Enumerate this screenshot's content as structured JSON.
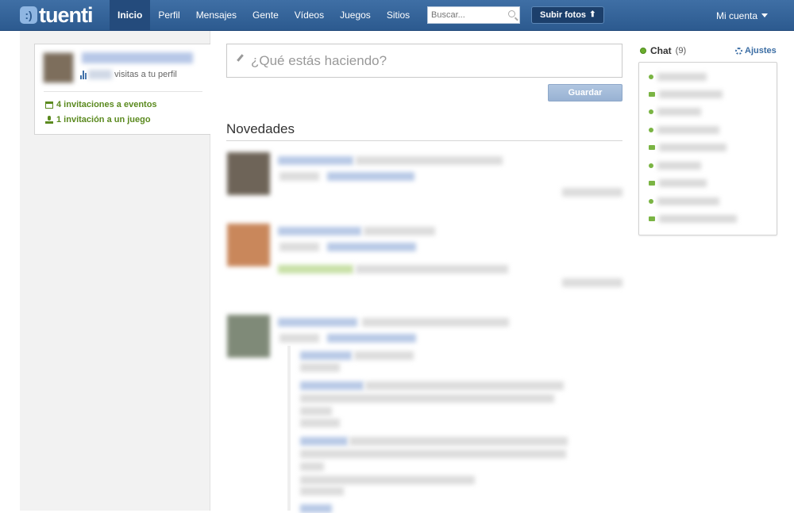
{
  "header": {
    "logo_text": "tuenti",
    "nav": [
      {
        "label": "Inicio",
        "active": true
      },
      {
        "label": "Perfil",
        "active": false
      },
      {
        "label": "Mensajes",
        "active": false
      },
      {
        "label": "Gente",
        "active": false
      },
      {
        "label": "Vídeos",
        "active": false
      },
      {
        "label": "Juegos",
        "active": false
      },
      {
        "label": "Sitios",
        "active": false
      }
    ],
    "search_placeholder": "Buscar...",
    "upload_label": "Subir fotos",
    "account_label": "Mi cuenta"
  },
  "profile": {
    "visits_suffix": "visitas a tu perfil",
    "invitations_events": "4 invitaciones a eventos",
    "invitations_games": "1 invitación a un juego"
  },
  "status": {
    "placeholder": "¿Qué estás haciendo?",
    "save_label": "Guardar"
  },
  "feed": {
    "title": "Novedades"
  },
  "chat": {
    "title": "Chat",
    "count": "(9)",
    "settings_label": "Ajustes",
    "contacts": [
      "dot",
      "cam",
      "dot",
      "dot",
      "cam",
      "dot",
      "cam",
      "dot",
      "cam"
    ]
  },
  "colors": {
    "header": "#2c5a8f",
    "active_nav": "#244b7c",
    "green_link": "#5b8a1f",
    "link_blue": "#3b6da4"
  }
}
